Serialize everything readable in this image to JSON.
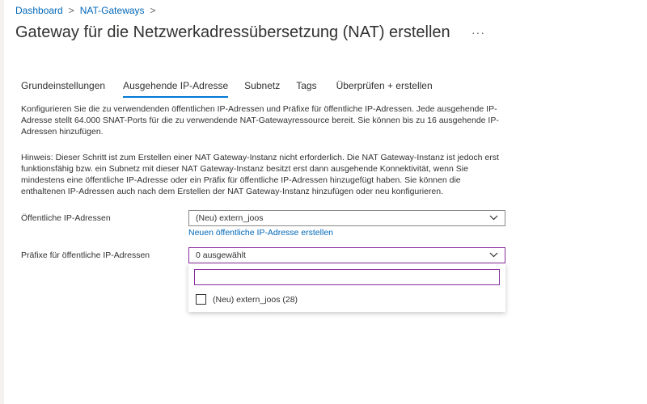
{
  "breadcrumb": {
    "items": [
      "Dashboard",
      "NAT-Gateways"
    ],
    "separator": ">"
  },
  "page": {
    "title": "Gateway für die Netzwerkadressübersetzung (NAT) erstellen",
    "more_label": "···"
  },
  "tabs": [
    {
      "label": "Grundeinstellungen",
      "active": false
    },
    {
      "label": "Ausgehende IP-Adresse",
      "active": true
    },
    {
      "label": "Subnetz",
      "active": false
    },
    {
      "label": "Tags",
      "active": false
    },
    {
      "label": "Überprüfen + erstellen",
      "active": false
    }
  ],
  "intro": {
    "paragraph1_lines": [
      "Konfigurieren Sie die zu verwendenden öffentlichen IP-Adressen und Präfixe für öffentliche IP-Adressen. Jede ausgehende IP-",
      "Adresse stellt 64.000 SNAT-Ports für die zu verwendende NAT-Gatewayressource bereit. Sie können bis zu 16 ausgehende IP-",
      "Adressen hinzufügen."
    ],
    "paragraph2_lines": [
      "Hinweis: Dieser Schritt ist zum Erstellen einer NAT Gateway-Instanz nicht erforderlich. Die NAT Gateway-Instanz ist jedoch erst",
      "funktionsfähig bzw. ein Subnetz mit dieser NAT Gateway-Instanz besitzt erst dann ausgehende Konnektivität, wenn Sie",
      "mindestens eine öffentliche IP-Adresse oder ein Präfix für öffentliche IP-Adressen hinzugefügt haben. Sie können die",
      "enthaltenen IP-Adressen auch nach dem Erstellen der NAT Gateway-Instanz hinzufügen oder neu konfigurieren."
    ]
  },
  "form": {
    "public_ip": {
      "label": "Öffentliche IP-Adressen",
      "value": "(Neu) extern_joos",
      "create_link": "Neuen öffentliche IP-Adresse erstellen"
    },
    "prefix": {
      "label": "Präfixe für öffentliche IP-Adressen",
      "value": "0 ausgewählt",
      "search_value": "",
      "options": [
        {
          "label": "(Neu) extern_joos (28)",
          "checked": false
        }
      ]
    }
  },
  "colors": {
    "accent": "#0078d4",
    "link": "#0067b8",
    "focus_border": "#8a2e9e"
  },
  "icons": {
    "dropdown": "chevron-down-icon"
  }
}
